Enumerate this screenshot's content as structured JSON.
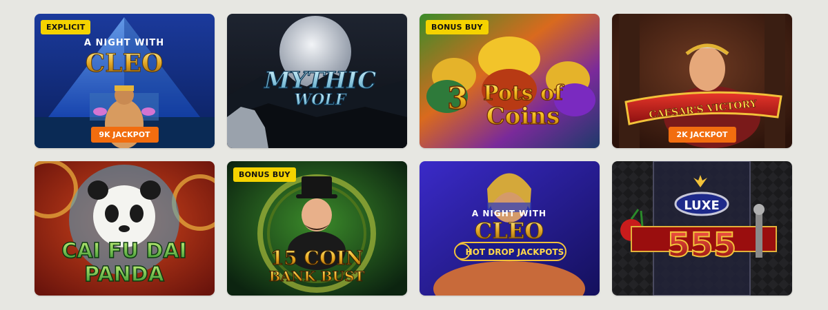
{
  "games": [
    {
      "title_top": "A NIGHT WITH",
      "title_main": "CLEO",
      "badge": "EXPLICIT",
      "jackpot": "9K JACKPOT"
    },
    {
      "title_main": "MYTHIC",
      "title_sub": "WOLF"
    },
    {
      "title_top": "3",
      "title_main": "Pots of",
      "title_sub": "Coins",
      "badge": "BONUS BUY"
    },
    {
      "title_main": "CAESAR'S VICTORY",
      "jackpot": "2K JACKPOT"
    },
    {
      "title_main": "CAI FU DAI",
      "title_sub": "PANDA"
    },
    {
      "title_main": "15 COIN",
      "title_sub": "BANK BUST",
      "badge": "BONUS BUY"
    },
    {
      "title_top": "A NIGHT WITH",
      "title_main": "CLEO",
      "title_sub": "HOT DROP JACKPOTS"
    },
    {
      "title_top": "LUXE",
      "title_main": "555"
    }
  ]
}
